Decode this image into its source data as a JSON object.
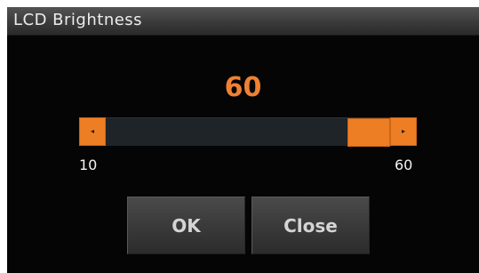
{
  "dialog": {
    "title": "LCD Brightness"
  },
  "brightness": {
    "value_display": "60",
    "value": 60,
    "min": 10,
    "max": 60,
    "min_label": "10",
    "max_label": "60",
    "decrease_glyph": "◂",
    "increase_glyph": "▸",
    "decrease_icon": "triangle-left-icon",
    "increase_icon": "triangle-right-icon"
  },
  "buttons": {
    "ok_label": "OK",
    "close_label": "Close"
  },
  "colors": {
    "accent": "#ee7e24",
    "value_text": "#ef8232",
    "track": "#1e2428",
    "dialog_bg": "#050505"
  }
}
